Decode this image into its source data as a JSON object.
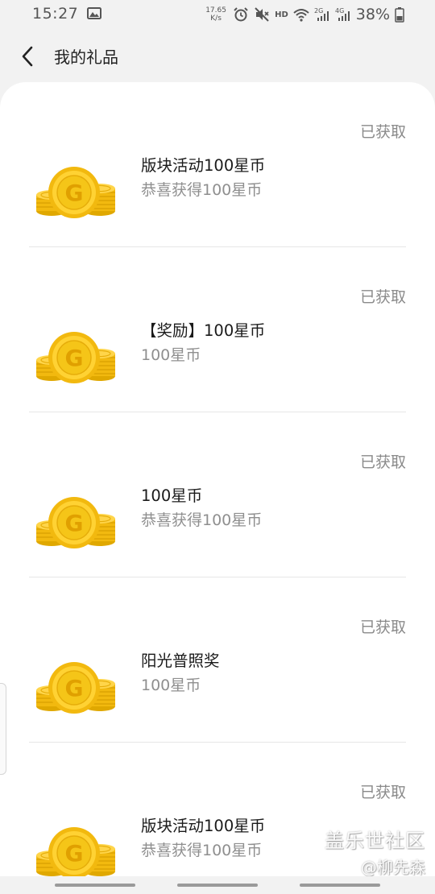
{
  "status_bar": {
    "time": "15:27",
    "net_speed_value": "17.65",
    "net_speed_unit": "K/s",
    "hd": "HD",
    "battery": "38%",
    "icons": [
      "image-icon",
      "alarm-icon",
      "mute-icon",
      "wifi-icon",
      "signal-2g-icon",
      "signal-4g-icon",
      "battery-icon"
    ]
  },
  "header": {
    "title": "我的礼品"
  },
  "gifts": [
    {
      "status": "已获取",
      "title": "版块活动100星币",
      "subtitle": "恭喜获得100星币"
    },
    {
      "status": "已获取",
      "title": "【奖励】100星币",
      "subtitle": "100星币"
    },
    {
      "status": "已获取",
      "title": "100星币",
      "subtitle": "恭喜获得100星币"
    },
    {
      "status": "已获取",
      "title": "阳光普照奖",
      "subtitle": "100星币"
    },
    {
      "status": "已获取",
      "title": "版块活动100星币",
      "subtitle": "恭喜获得100星币"
    }
  ],
  "watermark": {
    "brand": "盖乐世社区",
    "user": "@柳先森"
  },
  "colors": {
    "background": "#f2f2f2",
    "card": "#ffffff",
    "coin_gold": "#f5c518",
    "coin_dark": "#e0a800",
    "status_text": "#8a8a8a"
  }
}
